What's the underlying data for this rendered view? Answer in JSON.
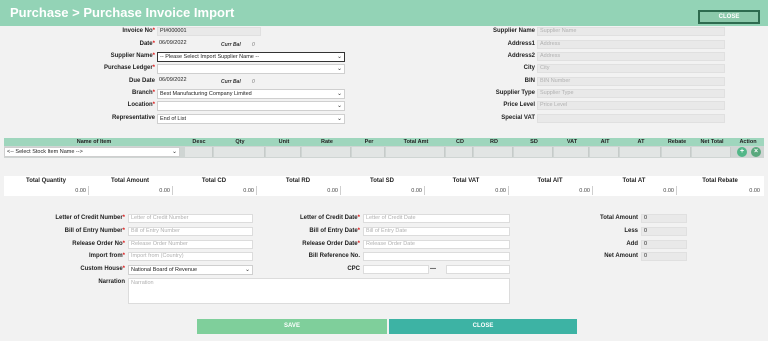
{
  "header": {
    "title": "Purchase > Purchase Invoice Import",
    "close_label": "CLOSE"
  },
  "left_form": {
    "invoice_no_label": "Invoice No",
    "invoice_no_value": "PI#000001",
    "date_label": "Date",
    "date_value": "06/09/2022",
    "curr_bal_label": "Curr Bal",
    "curr_bal_value": "0",
    "supplier_name_label": "Supplier Name",
    "supplier_name_value": "-- Please Select Import Supplier Name --",
    "purchase_ledger_label": "Purchase Ledger",
    "purchase_ledger_value": "",
    "due_date_label": "Due Date",
    "due_date_value": "06/09/2022",
    "due_curr_bal_label": "Curr Bal",
    "due_curr_bal_value": "0",
    "branch_label": "Branch",
    "branch_value": "Best Manufacturing Company Limited",
    "location_label": "Location",
    "location_value": "",
    "representative_label": "Representative",
    "representative_value": "End of List"
  },
  "right_form": {
    "supplier_name_label": "Supplier Name",
    "supplier_name_placeholder": "Supplier Name",
    "address1_label": "Address1",
    "address1_placeholder": "Address",
    "address2_label": "Address2",
    "address2_placeholder": "Address",
    "city_label": "City",
    "city_placeholder": "City",
    "bin_label": "BIN",
    "bin_placeholder": "BIN Number",
    "supplier_type_label": "Supplier Type",
    "supplier_type_placeholder": "Supplier Type",
    "price_level_label": "Price Level",
    "price_level_placeholder": "Price Level",
    "special_vat_label": "Special VAT"
  },
  "item_grid": {
    "columns": [
      "Name of Item",
      "Desc",
      "Qty",
      "Unit",
      "Rate",
      "Per",
      "Total Amt",
      "CD",
      "RD",
      "SD",
      "VAT",
      "AIT",
      "AT",
      "Rebate",
      "Net Total",
      "Action"
    ],
    "stock_item_select": "<-- Select Stock Item Name -->",
    "add_icon_glyph": "+",
    "remove_icon_glyph": "×"
  },
  "totals": {
    "headers": [
      "Total Quantity",
      "Total Amount",
      "Total CD",
      "Total RD",
      "Total SD",
      "Total VAT",
      "Total AIT",
      "Total AT",
      "Total Rebate"
    ],
    "values": [
      "0.00",
      "0.00",
      "0.00",
      "0.00",
      "0.00",
      "0.00",
      "0.00",
      "0.00",
      "0.00"
    ]
  },
  "bottom_form": {
    "lc_number_label": "Letter of Credit Number",
    "lc_number_placeholder": "Letter of Credit Number",
    "boe_number_label": "Bill of Entry Number",
    "boe_number_placeholder": "Bill of Entry Number",
    "release_order_no_label": "Release Order No",
    "release_order_no_placeholder": "Release Order Number",
    "import_from_label": "Import from",
    "import_from_placeholder": "Import from (Country)",
    "custom_house_label": "Custom House",
    "custom_house_value": "National Board of Revenue",
    "narration_label": "Narration",
    "narration_placeholder": "Narration",
    "lc_date_label": "Letter of Credit Date",
    "lc_date_placeholder": "Letter of Credit Date",
    "boe_date_label": "Bill of Entry Date",
    "boe_date_placeholder": "Bill of Entry Date",
    "release_order_date_label": "Release Order Date",
    "release_order_date_placeholder": "Release Order Date",
    "bill_ref_label": "Bill Reference No.",
    "cpc_label": "CPC",
    "cpc_separator": "—",
    "total_amount_label": "Total Amount",
    "total_amount_value": "0",
    "less_label": "Less",
    "less_value": "0",
    "add_label": "Add",
    "add_value": "0",
    "net_amount_label": "Net Amount",
    "net_amount_value": "0"
  },
  "footer": {
    "save_label": "SAVE",
    "close_label": "CLOSE"
  },
  "colors": {
    "title_bar": "#93d3b6",
    "grid_header": "#9fd6bd",
    "save_button": "#7fcf9b",
    "close_button": "#3db3a4",
    "required_mark": "#d11111"
  }
}
